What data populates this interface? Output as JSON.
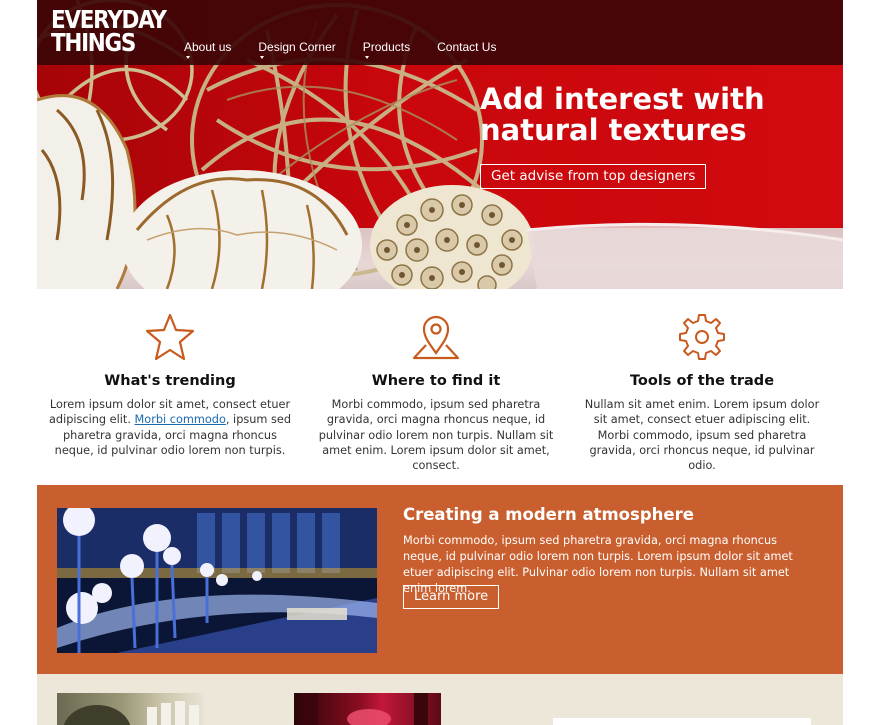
{
  "brand": {
    "logo_line1": "EVERYDAY",
    "logo_line2": "THINGS"
  },
  "nav": {
    "items": [
      {
        "label": "About us",
        "has_dropdown": true
      },
      {
        "label": "Design Corner",
        "has_dropdown": true
      },
      {
        "label": "Products",
        "has_dropdown": true
      },
      {
        "label": "Contact Us",
        "has_dropdown": false
      }
    ]
  },
  "hero": {
    "title_line1": "Add interest with",
    "title_line2": "natural textures",
    "button_label": "Get advise from top designers"
  },
  "features": [
    {
      "icon": "star-icon",
      "title": "What's trending",
      "text_before_link": "Lorem ipsum dolor sit amet, consect etuer adipiscing elit. ",
      "link": "Morbi commodo",
      "text_after_link": ", ipsum sed pharetra gravida, orci magna rhoncus neque, id pulvinar odio lorem non turpis."
    },
    {
      "icon": "map-pin-icon",
      "title": "Where to find it",
      "text": "Morbi commodo, ipsum sed pharetra gravida, orci magna rhoncus neque, id pulvinar odio lorem non turpis. Nullam sit amet enim. Lorem ipsum dolor sit amet, consect."
    },
    {
      "icon": "gear-icon",
      "title": "Tools of the trade",
      "text": "Nullam sit amet enim. Lorem ipsum dolor sit amet, consect etuer adipiscing elit. Morbi commodo, ipsum sed pharetra gravida, orci rhoncus neque, id pulvinar odio."
    }
  ],
  "band": {
    "title": "Creating a modern atmosphere",
    "text": "Morbi commodo, ipsum sed pharetra gravida, orci magna rhoncus neque, id pulvinar odio lorem non turpis. Lorem ipsum dolor sit amet etuer adipiscing elit. Pulvinar odio lorem non turpis. Nullam sit amet enim lorem.",
    "button_label": "Learn more"
  },
  "colors": {
    "nav_bg": "#3c0508",
    "hero_red": "#c9070c",
    "accent_orange": "#c95f2f",
    "icon_orange": "#c85a1e",
    "bottom_bg": "#ece7d9",
    "link_blue": "#1a6ab0"
  }
}
